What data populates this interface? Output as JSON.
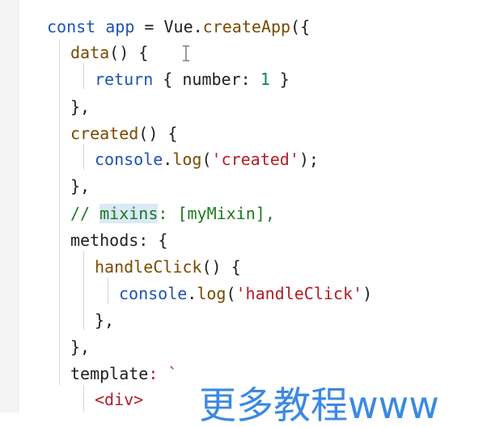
{
  "code_lines": [
    {
      "parts": [
        {
          "t": "const ",
          "c": "kw"
        },
        {
          "t": "app",
          "c": "kw"
        },
        {
          "t": " = ",
          "c": "prop"
        },
        {
          "t": "Vue",
          "c": "prop"
        },
        {
          "t": ".",
          "c": "prop"
        },
        {
          "t": "createApp",
          "c": "fn"
        },
        {
          "t": "({",
          "c": "prop"
        }
      ]
    },
    {
      "parts": [
        {
          "t": "data",
          "c": "fn"
        },
        {
          "t": "() { ",
          "c": "prop"
        }
      ]
    },
    {
      "parts": [
        {
          "t": "return",
          "c": "kw"
        },
        {
          "t": " { ",
          "c": "prop"
        },
        {
          "t": "number",
          "c": "prop"
        },
        {
          "t": ": ",
          "c": "prop"
        },
        {
          "t": "1",
          "c": "num"
        },
        {
          "t": " }",
          "c": "prop"
        }
      ]
    },
    {
      "parts": [
        {
          "t": "},",
          "c": "prop"
        }
      ]
    },
    {
      "parts": [
        {
          "t": "created",
          "c": "fn"
        },
        {
          "t": "() {",
          "c": "prop"
        }
      ]
    },
    {
      "parts": [
        {
          "t": "console",
          "c": "kw"
        },
        {
          "t": ".",
          "c": "prop"
        },
        {
          "t": "log",
          "c": "fn"
        },
        {
          "t": "(",
          "c": "prop"
        },
        {
          "t": "'created'",
          "c": "str"
        },
        {
          "t": ");",
          "c": "prop"
        }
      ]
    },
    {
      "parts": [
        {
          "t": "},",
          "c": "prop"
        }
      ]
    },
    {
      "parts": [
        {
          "t": "// ",
          "c": "com"
        },
        {
          "t": "mixins",
          "c": "com hl"
        },
        {
          "t": ": [myMixin],",
          "c": "com"
        }
      ]
    },
    {
      "parts": [
        {
          "t": "methods",
          "c": "prop"
        },
        {
          "t": ": {",
          "c": "prop"
        }
      ]
    },
    {
      "parts": [
        {
          "t": "handleClick",
          "c": "fn"
        },
        {
          "t": "() {",
          "c": "prop"
        }
      ]
    },
    {
      "parts": [
        {
          "t": "console",
          "c": "kw"
        },
        {
          "t": ".",
          "c": "prop"
        },
        {
          "t": "log",
          "c": "fn"
        },
        {
          "t": "(",
          "c": "prop"
        },
        {
          "t": "'handleClick'",
          "c": "str"
        },
        {
          "t": ")",
          "c": "prop"
        }
      ]
    },
    {
      "parts": [
        {
          "t": "},",
          "c": "prop"
        }
      ]
    },
    {
      "parts": [
        {
          "t": "},",
          "c": "prop"
        }
      ]
    },
    {
      "parts": [
        {
          "t": "template",
          "c": "prop"
        },
        {
          "t": ": `",
          "c": "str"
        }
      ]
    },
    {
      "parts": [
        {
          "t": "<div>",
          "c": "str"
        }
      ]
    }
  ],
  "watermark_text": "更多教程www"
}
